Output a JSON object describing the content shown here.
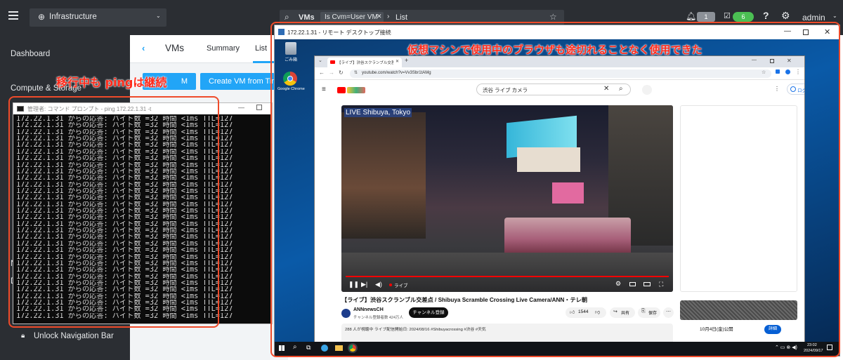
{
  "topbar": {
    "menu_icon": "hamburger-icon",
    "context_label": "Infrastructure",
    "context_icon": "globe-icon",
    "search_entity": "VMs",
    "filter_chip": "Is Cvm=User VM",
    "view_label": "List",
    "alerts_count": "1",
    "tasks_count": "6",
    "user": "admin"
  },
  "sidebar": {
    "items": [
      "Dashboard",
      "Compute & Storage"
    ],
    "partial_a": "N",
    "partial_b": "D",
    "unlock_label": "Unlock Navigation Bar"
  },
  "vms_page": {
    "title": "VMs",
    "tabs": [
      "Summary",
      "List"
    ],
    "create_vm_partial": "M",
    "create_vm_from_template": "Create VM from Tim"
  },
  "cmd": {
    "title": "管理者: コマンド プロンプト - ping  172.22.1.31  -t",
    "line": "172.22.1.31 からの応答: バイト数 =32 時間 <1ms TTL=127",
    "line_count": 31
  },
  "rdp": {
    "title": "172.22.1.31 - リモート デスクトップ接続",
    "desktop_icons": [
      "ごみ箱",
      "Google Chrome"
    ],
    "clock_time": "23:02",
    "clock_date": "2024/09/17"
  },
  "browser": {
    "tab_title": "【ライブ】渋谷スクランブル交差点 / Sh",
    "url": "youtube.com/watch?v=Vv3Sbr1tAMg",
    "search_query": "渋谷 ライブ カメラ",
    "login": "ログイン",
    "video_overlay": "LIVE Shibuya, Tokyo",
    "live_badge": "ライブ",
    "video_title": "【ライブ】渋谷スクランブル交差点 / Shibuya Scramble Crossing Live Camera/ANN・テレ朝",
    "channel": "ANNnewsCH",
    "subscribers": "チャンネル登録者数 424万人",
    "subscribe": "チャンネル登録",
    "likes": "1544",
    "share": "共有",
    "save": "保存",
    "watching": "288 人が視聴中  ライブ配信開始日: 2024/08/16  #Shibuyacrossing  #渋谷  #天気",
    "side_date": "10月4日(金)公開",
    "side_detail": "詳細"
  },
  "annotations": {
    "ping": "移行中も pingは継続",
    "browser": "仮想マシンで使用中のブラウザも途切れることなく使用できた"
  },
  "colors": {
    "nav_dark": "#2b2e33",
    "accent_blue": "#22a5f7",
    "callout_red": "#ef4b2a",
    "yt_red": "#ff0000"
  }
}
